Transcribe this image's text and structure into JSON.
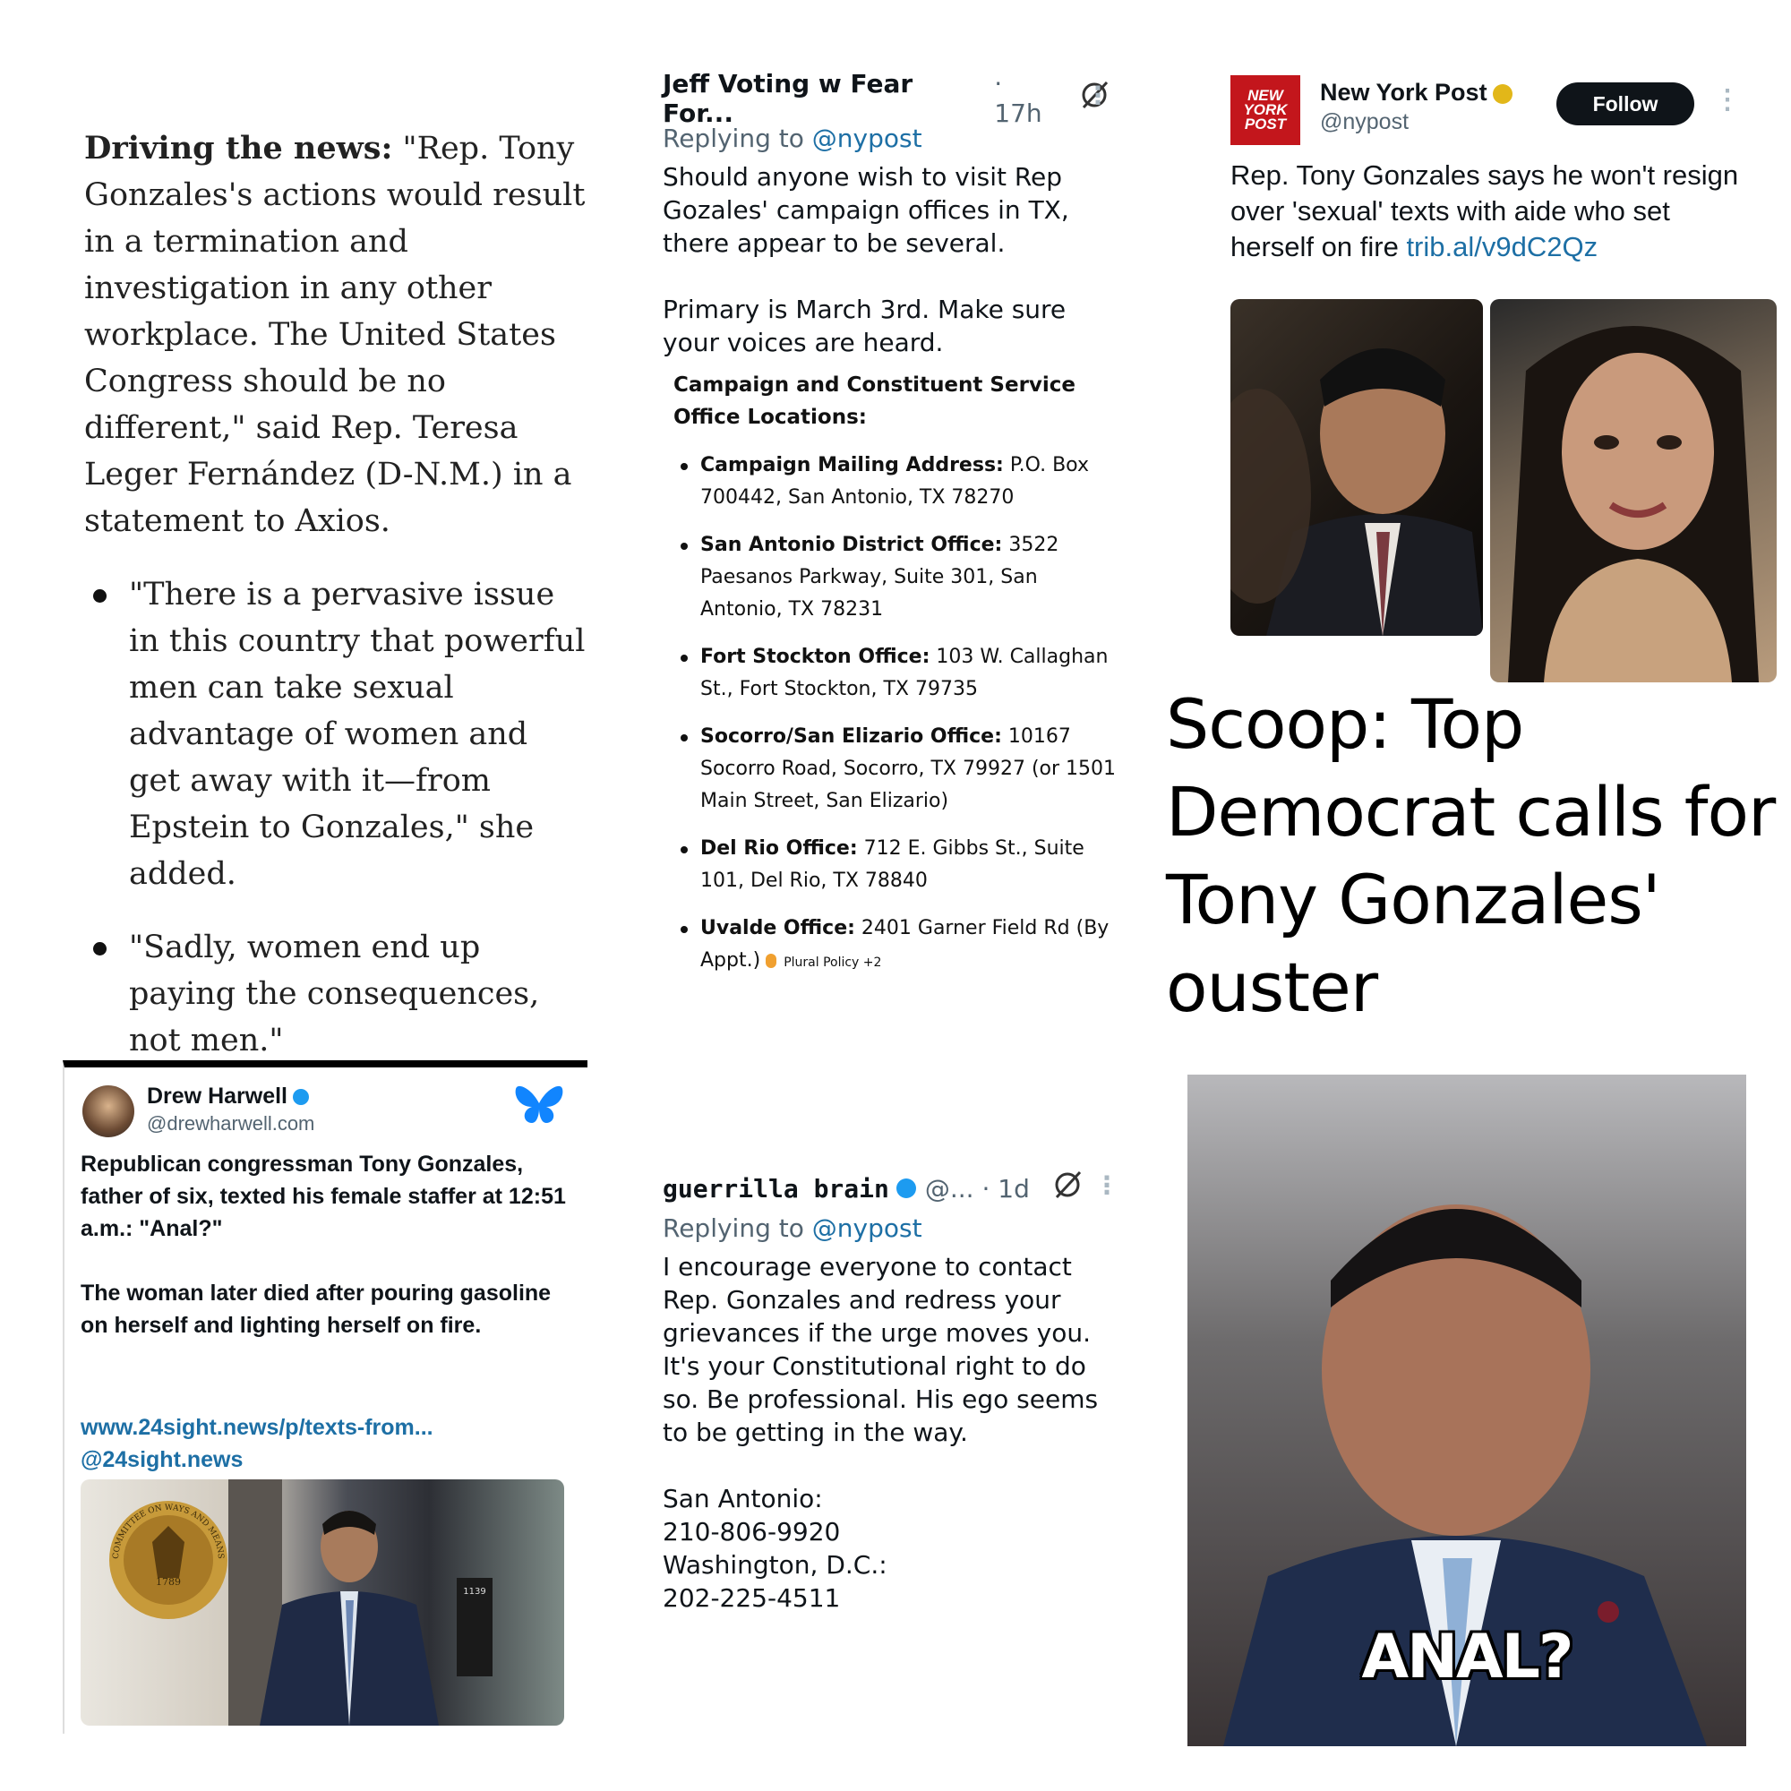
{
  "axios": {
    "lead_bold": "Driving the news:",
    "lead_text": " \"Rep. Tony Gonzales's actions would result in a termination and investigation in any other workplace. The United States Congress should be no different,\" said Rep. Teresa Leger Fernández (D-N.M.) in a statement to Axios.",
    "bullets": [
      "\"There is a pervasive issue in this country that powerful men can take sexual advantage of women and get away with it—from Epstein to Gonzales,\" she added.",
      "\"Sadly, women end up paying the consequences, not men.\""
    ]
  },
  "reply1": {
    "name": "Jeff Voting w Fear For...",
    "meta": "· 17h",
    "replying_prefix": "Replying to ",
    "replying_handle": "@nypost",
    "body": "Should anyone wish to visit Rep Gozales' campaign offices in TX, there appear to be several.\n\nPrimary is March 3rd. Make sure your voices are heard."
  },
  "offices": {
    "title": "Campaign and Constituent Service Office Locations:",
    "items": [
      {
        "label": "Campaign Mailing Address:",
        "text": " P.O. Box 700442, San Antonio, TX 78270"
      },
      {
        "label": "San Antonio District Office:",
        "text": " 3522 Paesanos Parkway, Suite 301, San Antonio, TX 78231"
      },
      {
        "label": "Fort Stockton Office:",
        "text": " 103 W. Callaghan St., Fort Stockton, TX 79735"
      },
      {
        "label": "Socorro/San Elizario Office:",
        "text": " 10167 Socorro Road, Socorro, TX 79927 (or 1501 Main Street, San Elizario)"
      },
      {
        "label": "Del Rio Office:",
        "text": " 712 E. Gibbs St., Suite 101, Del Rio, TX 78840"
      },
      {
        "label": "Uvalde Office:",
        "text": " 2401 Garner Field Rd (By Appt.)"
      }
    ],
    "plural_note": "Plural Policy +2"
  },
  "nypost": {
    "logo_text": "NEW YORK POST",
    "name": "New York Post",
    "handle": "@nypost",
    "follow_label": "Follow",
    "text": "Rep. Tony Gonzales says he won't resign over 'sexual' texts with aide who set herself on fire ",
    "link": "trib.al/v9dC2Qz"
  },
  "headline": "Scoop: Top Democrat calls for Tony Gonzales' ouster",
  "harwell": {
    "name": "Drew Harwell",
    "handle": "@drewharwell.com",
    "text": "Republican congressman Tony Gonzales, father of six, texted his female staffer at 12:51 a.m.: \"Anal?\"\n\nThe woman later died after pouring gasoline on herself and lighting herself on fire.",
    "link1": "www.24sight.news/p/texts-from...",
    "link2": "@24sight.news",
    "seal_text": "COMMITTEE ON WAYS AND MEANS",
    "seal_year": "1789",
    "door_number": "1139"
  },
  "reply2": {
    "name": "guerrilla brain",
    "meta": "@... · 1d",
    "replying_prefix": "Replying to ",
    "replying_handle": "@nypost",
    "body": "I encourage everyone to contact Rep. Gonzales and redress your grievances if the urge moves you. It's your Constitutional right to do so. Be professional. His ego seems to be getting in the way.\n\nSan Antonio:\n210-806-9920\nWashington, D.C.:\n202-225-4511"
  },
  "meme": {
    "caption": "ANAL?"
  },
  "colors": {
    "link": "#1d6fa5",
    "nypost_red": "#c3161c",
    "bluesky": "#1185fe"
  }
}
